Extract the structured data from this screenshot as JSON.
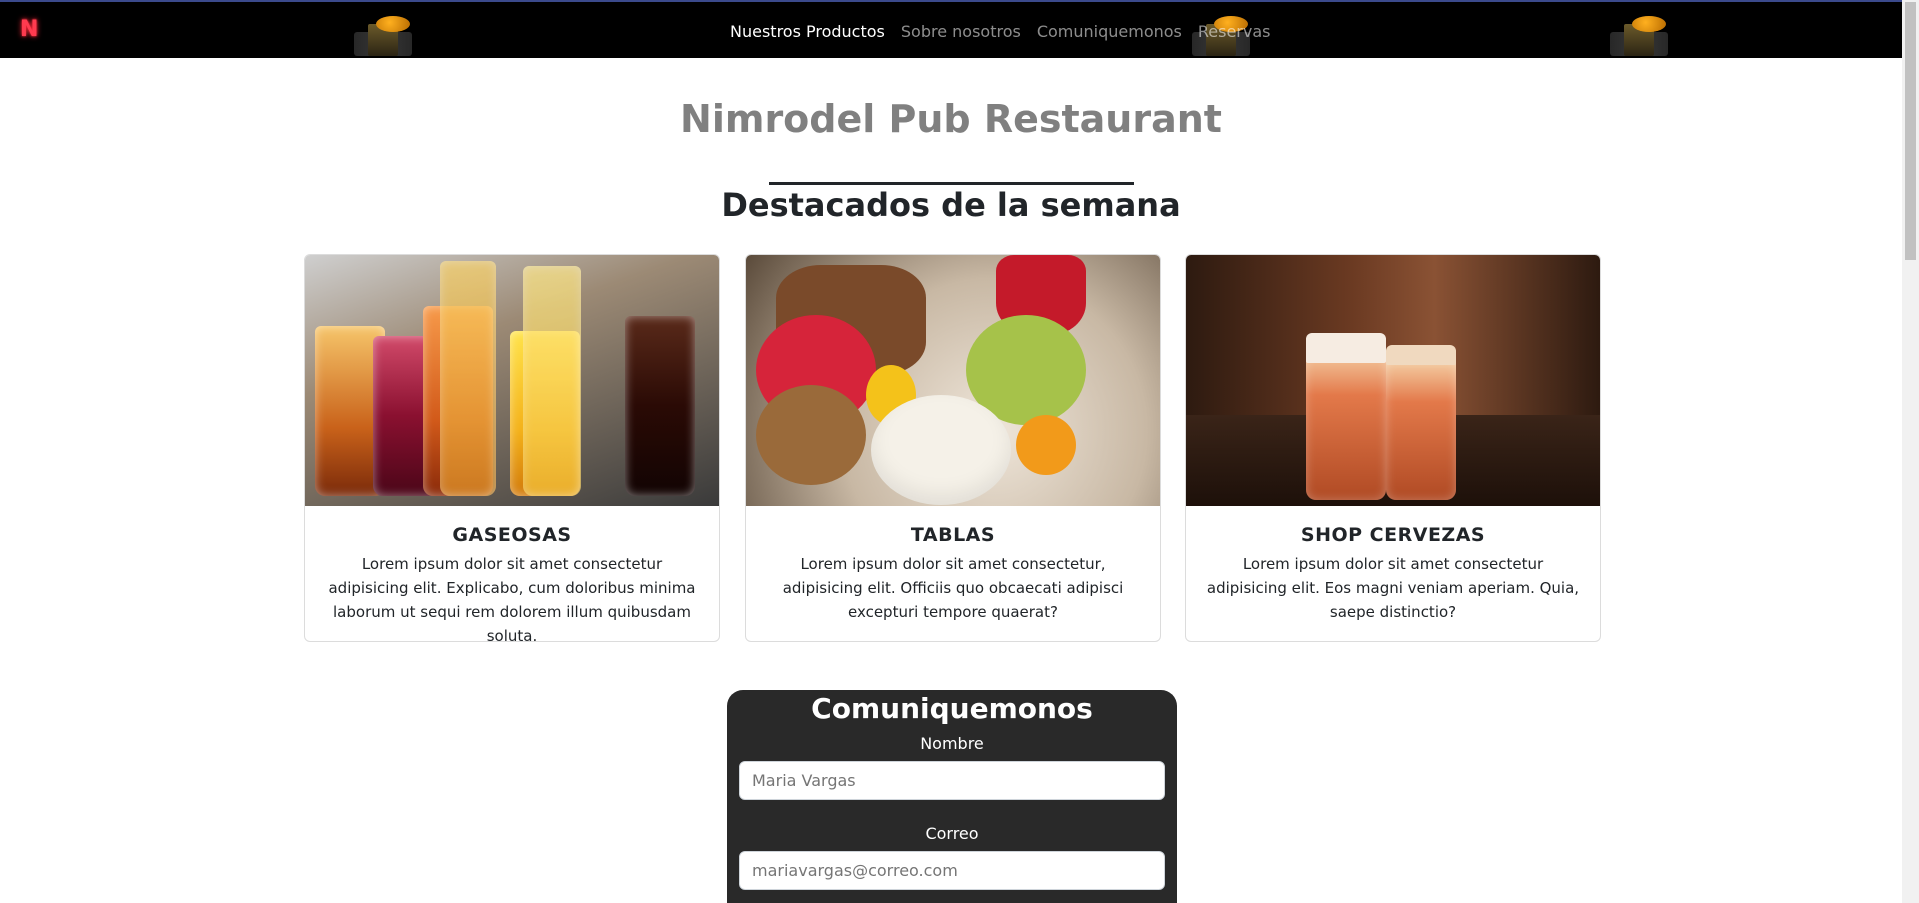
{
  "navbar": {
    "brand": "N",
    "links": [
      "Nuestros Productos",
      "Sobre nosotros",
      "Comuniquemonos",
      "Reservas"
    ],
    "active_index": 0
  },
  "page": {
    "title": "Nimrodel Pub Restaurant",
    "section_title": "Destacados de la semana"
  },
  "cards": [
    {
      "title": "GASEOSAS",
      "text": "Lorem ipsum dolor sit amet consectetur adipisicing elit. Explicabo, cum doloribus minima laborum ut sequi rem dolorem illum quibusdam soluta."
    },
    {
      "title": "TABLAS",
      "text": "Lorem ipsum dolor sit amet consectetur, adipisicing elit. Officiis quo obcaecati adipisci excepturi tempore quaerat?"
    },
    {
      "title": "SHOP CERVEZAS",
      "text": "Lorem ipsum dolor sit amet consectetur adipisicing elit. Eos magni veniam aperiam. Quia, saepe distinctio?"
    }
  ],
  "contact": {
    "title": "Comuniquemonos",
    "name_label": "Nombre",
    "name_placeholder": "Maria Vargas",
    "email_label": "Correo",
    "email_placeholder": "mariavargas@correo.com"
  },
  "colors": {
    "navbar_bg": "#000000",
    "brand": "#ff3b4f",
    "title": "#808080",
    "form_bg": "#292929"
  }
}
